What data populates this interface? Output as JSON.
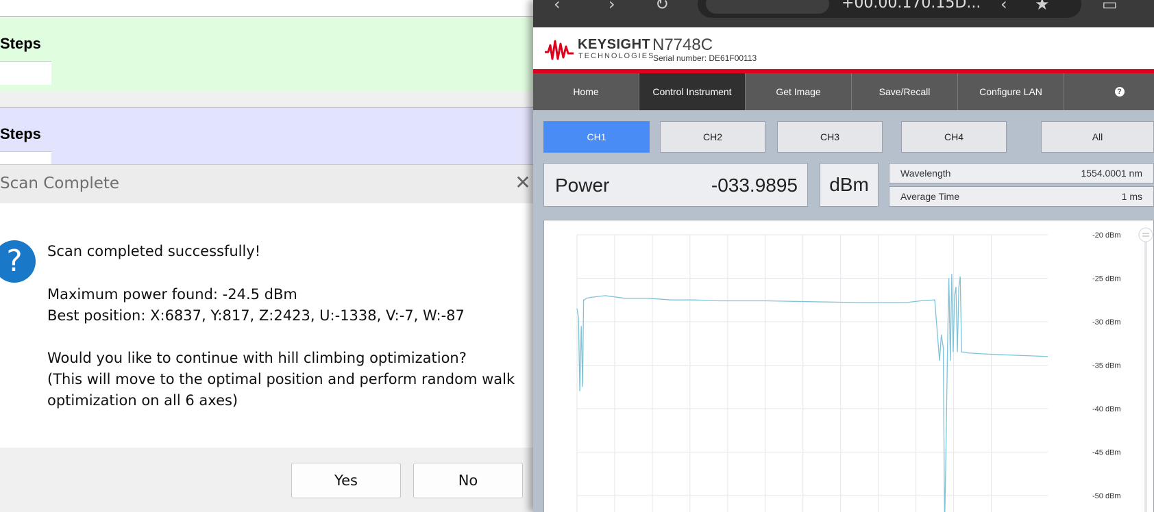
{
  "left_app": {
    "sections": [
      {
        "title": "Steps"
      },
      {
        "title": "Steps"
      }
    ]
  },
  "dialog": {
    "title": "Scan Complete",
    "close_glyph": "✕",
    "icon_glyph": "?",
    "lines": [
      "Scan completed successfully!",
      "Maximum power found: -24.5 dBm",
      "Best position: X:6837, Y:817, Z:2423, U:-1338, V:-7, W:-87",
      "Would you like to continue with hill climbing optimization?",
      "(This will move to the optimal position and perform random walk",
      "optimization on all 6 axes)"
    ],
    "yes_label": "Yes",
    "no_label": "No"
  },
  "browser": {
    "url_text": "+00.00.170.15D..."
  },
  "instrument": {
    "brand": "KEYSIGHT",
    "brand_sub": "TECHNOLOGIES",
    "model": "N7748C",
    "serial": "Serial number: DE61F00113",
    "brand_color": "#e0001b",
    "nav": [
      "Home",
      "Control Instrument",
      "Get Image",
      "Save/Recall",
      "Configure LAN"
    ],
    "nav_active": "Control Instrument",
    "help_glyph": "?",
    "channels": [
      "CH1",
      "CH2",
      "CH3",
      "CH4",
      "All"
    ],
    "channel_active": "CH1",
    "power_label": "Power",
    "power_value": "-033.9895",
    "power_unit": "dBm",
    "wavelength_label": "Wavelength",
    "wavelength_value": "1554.0001 nm",
    "avg_time_label": "Average Time",
    "avg_time_value": "1 ms"
  },
  "chart_data": {
    "type": "line",
    "y_unit": "dBm",
    "ylim": [
      -53,
      -20
    ],
    "yticks": [
      -20,
      -25,
      -30,
      -35,
      -40,
      -45,
      -50
    ],
    "ytick_labels": [
      "-20 dBm",
      "-25 dBm",
      "-30 dBm",
      "-35 dBm",
      "-40 dBm",
      "-45 dBm",
      "-50 dBm"
    ],
    "xlim": [
      0,
      100
    ],
    "grid": true,
    "series_color": "#7ec3d8",
    "x": [
      0,
      0.3,
      0.6,
      0.9,
      1.2,
      1.4,
      1.6,
      2.0,
      3,
      6,
      10,
      15,
      20,
      25,
      30,
      40,
      50,
      60,
      70,
      73,
      76,
      77,
      77.4,
      77.8,
      78.1,
      78.4,
      78.7,
      79,
      79.3,
      79.6,
      79.9,
      80.2,
      80.5,
      80.8,
      81.1,
      81.4,
      81.7,
      82,
      82.3,
      82.6,
      82.9,
      83.2,
      86,
      90,
      95,
      100
    ],
    "y": [
      -28.5,
      -29.5,
      -38.0,
      -30.5,
      -37.5,
      -27.5,
      -27.5,
      -27.3,
      -27.2,
      -27.0,
      -27.3,
      -27.3,
      -27.5,
      -27.5,
      -27.6,
      -27.6,
      -27.7,
      -27.8,
      -27.8,
      -27.6,
      -27.5,
      -34.5,
      -31.5,
      -33.0,
      -53.5,
      -44.0,
      -33.0,
      -25.0,
      -34.5,
      -24.5,
      -33.5,
      -27.0,
      -26.0,
      -33.5,
      -26.0,
      -24.8,
      -33.5,
      -33.5,
      -33.5,
      -33.5,
      -33.6,
      -33.6,
      -33.7,
      -33.8,
      -33.9,
      -34.0
    ]
  }
}
